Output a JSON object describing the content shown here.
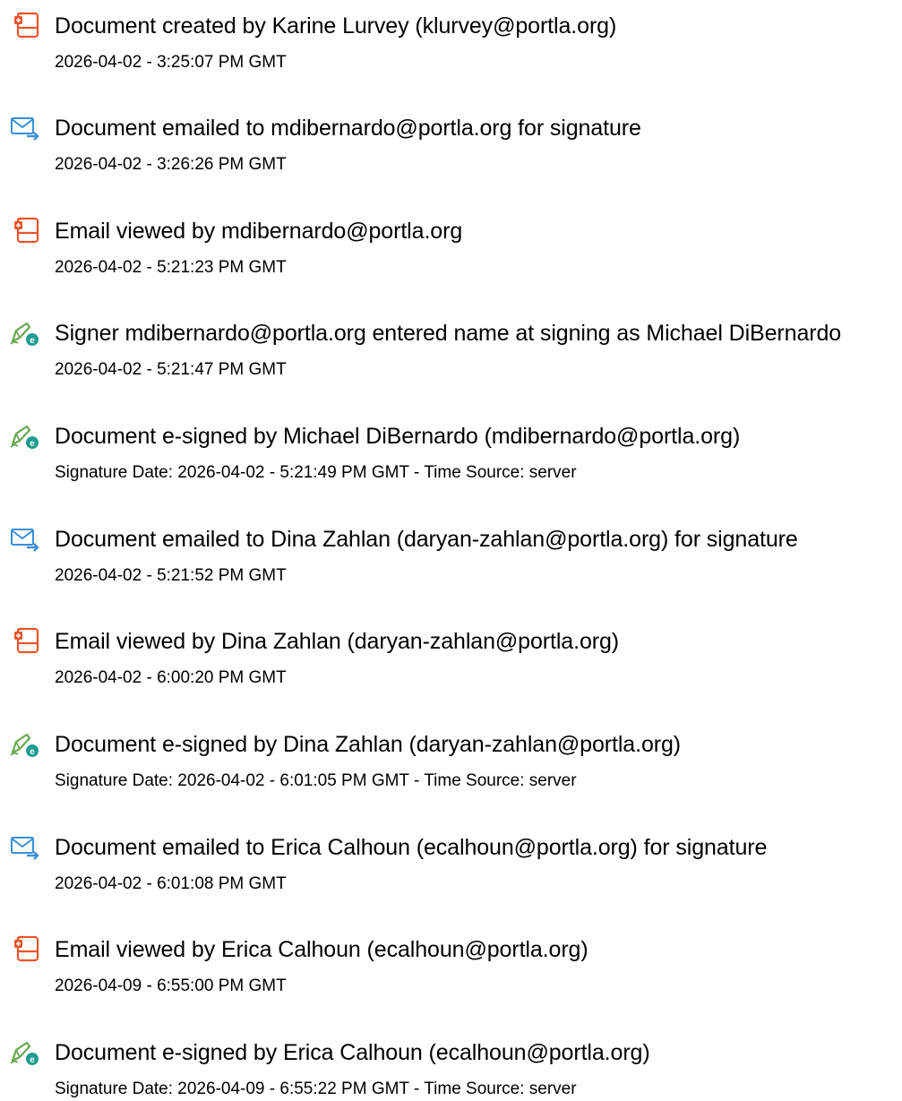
{
  "events": [
    {
      "icon": "document-icon",
      "title": "Document created by Karine Lurvey (klurvey@portla.org)",
      "meta": "2026-04-02 - 3:25:07 PM GMT"
    },
    {
      "icon": "email-sent-icon",
      "title": "Document emailed to mdibernardo@portla.org for signature",
      "meta": "2026-04-02 - 3:26:26 PM GMT"
    },
    {
      "icon": "document-icon",
      "title": "Email viewed by mdibernardo@portla.org",
      "meta": "2026-04-02 - 5:21:23 PM GMT"
    },
    {
      "icon": "e-sign-pen-icon",
      "title": "Signer mdibernardo@portla.org entered name at signing as Michael DiBernardo",
      "meta": "2026-04-02 - 5:21:47 PM GMT"
    },
    {
      "icon": "e-sign-pen-icon",
      "title": "Document e-signed by Michael DiBernardo (mdibernardo@portla.org)",
      "meta": "Signature Date: 2026-04-02 - 5:21:49 PM GMT - Time Source: server"
    },
    {
      "icon": "email-sent-icon",
      "title": "Document emailed to Dina Zahlan (daryan-zahlan@portla.org) for signature",
      "meta": "2026-04-02 - 5:21:52 PM GMT"
    },
    {
      "icon": "document-icon",
      "title": "Email viewed by Dina Zahlan (daryan-zahlan@portla.org)",
      "meta": "2026-04-02 - 6:00:20 PM GMT"
    },
    {
      "icon": "e-sign-pen-icon",
      "title": "Document e-signed by Dina Zahlan (daryan-zahlan@portla.org)",
      "meta": "Signature Date: 2026-04-02 - 6:01:05 PM GMT - Time Source: server"
    },
    {
      "icon": "email-sent-icon",
      "title": "Document emailed to Erica Calhoun (ecalhoun@portla.org) for signature",
      "meta": "2026-04-02 - 6:01:08 PM GMT"
    },
    {
      "icon": "document-icon",
      "title": "Email viewed by Erica Calhoun (ecalhoun@portla.org)",
      "meta": "2026-04-09 - 6:55:00 PM GMT"
    },
    {
      "icon": "e-sign-pen-icon",
      "title": "Document e-signed by Erica Calhoun (ecalhoun@portla.org)",
      "meta": "Signature Date: 2026-04-09 - 6:55:22 PM GMT - Time Source: server"
    }
  ],
  "colors": {
    "document_icon": "#e8552b",
    "email_icon": "#3a8fd8",
    "pen_icon": "#6aa84f",
    "badge": "#1f9e8f"
  }
}
